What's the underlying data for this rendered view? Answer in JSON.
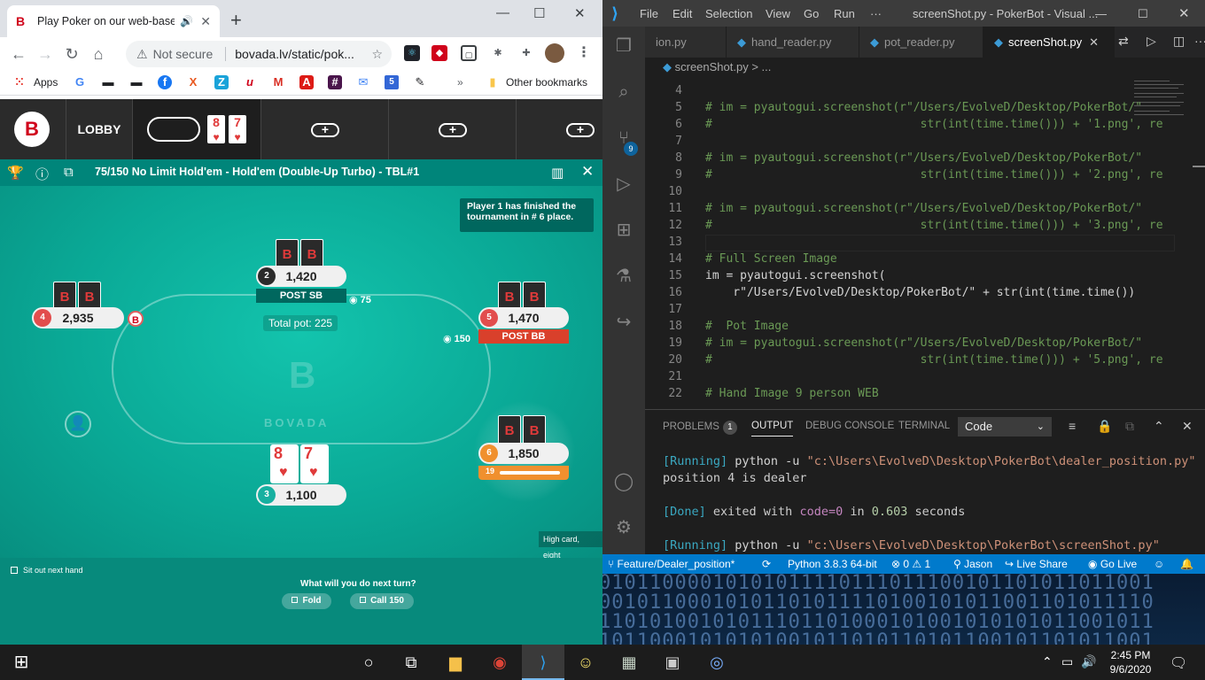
{
  "chrome": {
    "tab_title": "Play Poker on our web-base",
    "not_secure": "Not secure",
    "url": "bovada.lv/static/pok...",
    "bookmarks": {
      "apps": "Apps",
      "other": "Other bookmarks"
    }
  },
  "poker": {
    "lobby": "LOBBY",
    "mini_cards": [
      "8",
      "7"
    ],
    "table_title": "75/150 No Limit Hold'em - Hold'em (Double-Up Turbo) - TBL#1",
    "notice": "Player 1 has finished the tournament in # 6 place.",
    "total_pot": "Total pot: 225",
    "brand": "BOVADA",
    "seats": [
      {
        "num": "4",
        "stack": "2,935"
      },
      {
        "num": "2",
        "stack": "1,420",
        "status": "POST SB",
        "bet": "75"
      },
      {
        "num": "5",
        "stack": "1,470",
        "status": "POST BB",
        "bet": "150"
      },
      {
        "num": "6",
        "stack": "1,850",
        "timer": "19"
      },
      {
        "num": "3",
        "stack": "1,100",
        "cards": [
          "8",
          "7"
        ]
      }
    ],
    "hand_rank": "High card, eight",
    "sit_out": "Sit out next hand",
    "question": "What will you do next turn?",
    "fold": "Fold",
    "call": "Call 150"
  },
  "vscode": {
    "menu": [
      "File",
      "Edit",
      "Selection",
      "View",
      "Go",
      "Run",
      "···"
    ],
    "window_title": "screenShot.py - PokerBot - Visual ...",
    "tabs": [
      "ion.py",
      "hand_reader.py",
      "pot_reader.py",
      "screenShot.py"
    ],
    "breadcrumb": "screenShot.py > ...",
    "scm_badge": "9",
    "code": [
      {
        "n": "4",
        "t": ""
      },
      {
        "n": "5",
        "t": "# im = pyautogui.screenshot(r\"/Users/EvolveD/Desktop/PokerBot/\""
      },
      {
        "n": "6",
        "t": "#                              str(int(time.time())) + '1.png', re"
      },
      {
        "n": "7",
        "t": ""
      },
      {
        "n": "8",
        "t": "# im = pyautogui.screenshot(r\"/Users/EvolveD/Desktop/PokerBot/\""
      },
      {
        "n": "9",
        "t": "#                              str(int(time.time())) + '2.png', re"
      },
      {
        "n": "10",
        "t": ""
      },
      {
        "n": "11",
        "t": "# im = pyautogui.screenshot(r\"/Users/EvolveD/Desktop/PokerBot/\""
      },
      {
        "n": "12",
        "t": "#                              str(int(time.time())) + '3.png', re"
      },
      {
        "n": "13",
        "t": ""
      },
      {
        "n": "14",
        "t": "# Full Screen Image"
      },
      {
        "n": "15",
        "t": "im = pyautogui.screenshot("
      },
      {
        "n": "16",
        "t": "    r\"/Users/EvolveD/Desktop/PokerBot/\" + str(int(time.time())"
      },
      {
        "n": "17",
        "t": ""
      },
      {
        "n": "18",
        "t": "#  Pot Image"
      },
      {
        "n": "19",
        "t": "# im = pyautogui.screenshot(r\"/Users/EvolveD/Desktop/PokerBot/\""
      },
      {
        "n": "20",
        "t": "#                              str(int(time.time())) + '5.png', re"
      },
      {
        "n": "21",
        "t": ""
      },
      {
        "n": "22",
        "t": "# Hand Image 9 person WEB"
      }
    ],
    "panel_tabs": {
      "problems": "PROBLEMS",
      "problems_count": "1",
      "output": "OUTPUT",
      "debug": "DEBUG CONSOLE",
      "terminal": "TERMINAL"
    },
    "output_channel": "Code",
    "output": {
      "l1_tag": "[Running]",
      "l1_cmd": " python -u ",
      "l1_path": "\"c:\\Users\\EvolveD\\Desktop\\PokerBot\\dealer_position.py\"",
      "l2": "position 4 is dealer",
      "l3_tag": "[Done]",
      "l3_a": " exited with ",
      "l3_code": "code=0",
      "l3_b": " in ",
      "l3_time": "0.603",
      "l3_c": " seconds",
      "l4_tag": "[Running]",
      "l4_cmd": " python -u ",
      "l4_path": "\"c:\\Users\\EvolveD\\Desktop\\PokerBot\\screenShot.py\""
    },
    "status": {
      "branch": "Feature/Dealer_position*",
      "python": "Python 3.8.3 64-bit",
      "errors": "0",
      "warnings": "1",
      "user": "Jason",
      "live_share": "Live Share",
      "go_live": "Go Live"
    }
  },
  "wallpaper": {
    "rows": [
      "01011000010101011110111011100101101011011001",
      "00101100010101101011110100101011001101011110",
      "11010100101011101101000101001010101011001011",
      "10110001010101001011010110101100101101011001"
    ]
  },
  "taskbar": {
    "time": "2:45 PM",
    "date": "9/6/2020"
  }
}
